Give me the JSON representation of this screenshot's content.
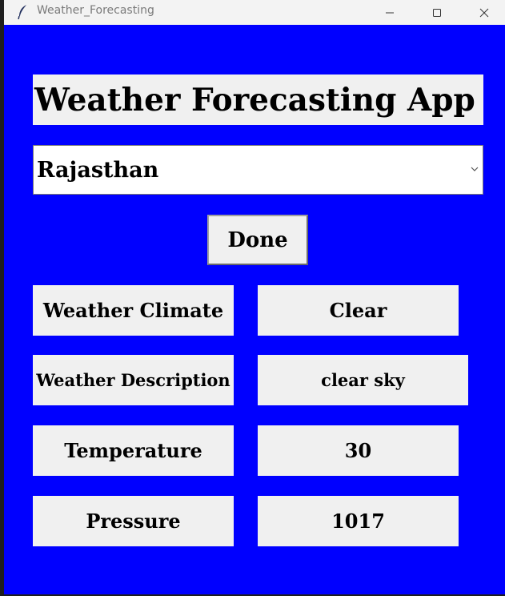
{
  "window": {
    "title": "Weather_Forecasting",
    "app_icon": "feather-icon",
    "background_color": "#0000ff",
    "controls": {
      "minimize_icon": "minimize-icon",
      "maximize_icon": "maximize-icon",
      "close_icon": "close-icon"
    }
  },
  "app": {
    "heading": "Weather Forecasting  App",
    "location_select": {
      "selected": "Rajasthan",
      "dropdown_icon": "chevron-down-icon"
    },
    "done_label": "Done",
    "rows": [
      {
        "label": "Weather Climate",
        "value": "Clear"
      },
      {
        "label": "Weather Description",
        "value": "clear sky"
      },
      {
        "label": "Temperature",
        "value": "30"
      },
      {
        "label": "Pressure",
        "value": "1017"
      }
    ]
  }
}
